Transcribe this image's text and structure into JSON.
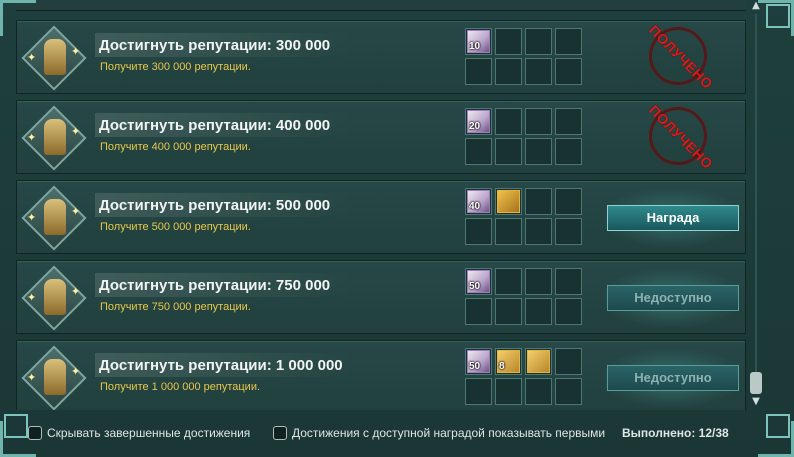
{
  "rows": [
    {
      "title": "Достигнуть репутации: 300 000",
      "subtitle": "Получите 300 000 репутации.",
      "items": [
        {
          "kind": "rep",
          "count": "10"
        }
      ],
      "status": "received",
      "status_label": "ПОЛУЧЕНО"
    },
    {
      "title": "Достигнуть репутации: 400 000",
      "subtitle": "Получите 400 000 репутации.",
      "items": [
        {
          "kind": "rep",
          "count": "20"
        }
      ],
      "status": "received",
      "status_label": "ПОЛУЧЕНО"
    },
    {
      "title": "Достигнуть репутации: 500 000",
      "subtitle": "Получите 500 000 репутации.",
      "items": [
        {
          "kind": "rep",
          "count": "40"
        },
        {
          "kind": "scroll",
          "count": ""
        }
      ],
      "status": "claim",
      "button_label": "Награда"
    },
    {
      "title": "Достигнуть репутации: 750 000",
      "subtitle": "Получите 750 000 репутации.",
      "items": [
        {
          "kind": "rep",
          "count": "50"
        }
      ],
      "status": "unavailable",
      "button_label": "Недоступно"
    },
    {
      "title": "Достигнуть репутации: 1 000 000",
      "subtitle": "Получите 1 000 000 репутации.",
      "items": [
        {
          "kind": "rep",
          "count": "50"
        },
        {
          "kind": "chest",
          "count": "8"
        },
        {
          "kind": "chest",
          "count": ""
        }
      ],
      "status": "unavailable",
      "button_label": "Недоступно"
    }
  ],
  "footer": {
    "hide_completed_label": "Скрывать завершенные достижения",
    "show_rewards_first_label": "Достижения с доступной наградой показывать первыми",
    "progress_label": "Выполнено: 12/38"
  },
  "colors": {
    "background": "#1c3a38",
    "subtitle": "#e8c64b",
    "stamp": "#d81b1b",
    "button": "#2f8a8c"
  }
}
